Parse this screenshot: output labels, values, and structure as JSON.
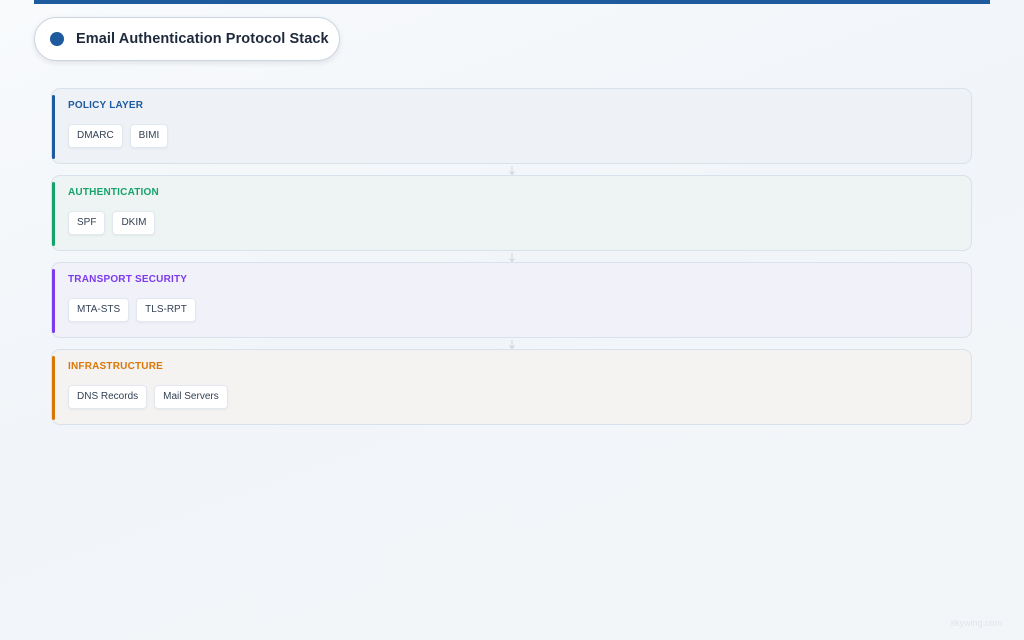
{
  "title": "Email Authentication Protocol Stack",
  "colors": {
    "accent": "#1e5a9e"
  },
  "layers": [
    {
      "label": "POLICY LAYER",
      "color": "#1e5a9e",
      "background": "#eef2f7",
      "items": [
        "DMARC",
        "BIMI"
      ]
    },
    {
      "label": "AUTHENTICATION",
      "color": "#16a36a",
      "background": "#edf4f3",
      "items": [
        "SPF",
        "DKIM"
      ]
    },
    {
      "label": "TRANSPORT SECURITY",
      "color": "#7c3aed",
      "background": "#f1f1fa",
      "items": [
        "MTA-STS",
        "TLS-RPT"
      ]
    },
    {
      "label": "INFRASTRUCTURE",
      "color": "#d97706",
      "background": "#f5f3f1",
      "items": [
        "DNS Records",
        "Mail Servers"
      ]
    }
  ],
  "watermark": "skywing.com"
}
